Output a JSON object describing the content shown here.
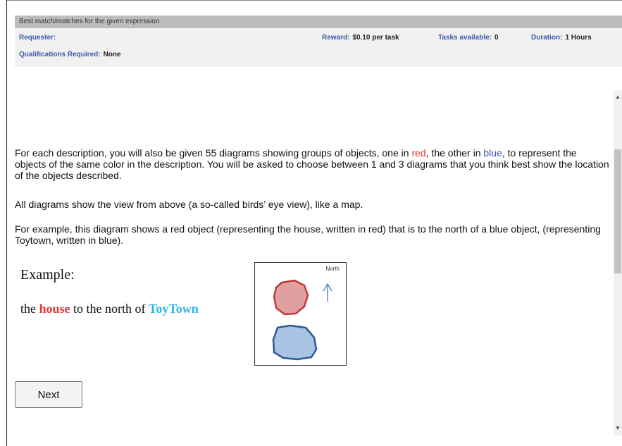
{
  "hit": {
    "title": "Best match/matches for the given expression",
    "requester_label": "Requester:",
    "reward_label": "Reward:",
    "reward_value": "$0.10 per task",
    "tasks_label": "Tasks available:",
    "tasks_value": "0",
    "duration_label": "Duration:",
    "duration_value": "1 Hours",
    "qualifications_label": "Qualifications Required:",
    "qualifications_value": "None"
  },
  "instructions": {
    "p1_a": "For each description, you will also be given 55 diagrams showing groups of objects, one in ",
    "p1_red": "red",
    "p1_b": ", the other in ",
    "p1_blue": "blue",
    "p1_c": ", to represent the objects of the same color in the description. You will be asked to choose between 1 and 3 diagrams that you think best show the location of the objects described.",
    "p2": "All diagrams show the view from above (a so-called birds’ eye view), like a map.",
    "p3": "For example, this diagram shows a red object (representing the house, written in red) that is to the north of a blue object, (representing Toytown, written in blue)."
  },
  "example": {
    "label": "Example:",
    "phrase_1": "the ",
    "phrase_red": "house",
    "phrase_2": " to the north of ",
    "phrase_cyan": "ToyTown",
    "diagram_north_label": "North",
    "colors": {
      "red_fill": "#e0a0a0",
      "red_stroke": "#c0393b",
      "blue_fill": "#a8c4e2",
      "blue_stroke": "#2c5a92",
      "arrow": "#5b8cc9"
    }
  },
  "buttons": {
    "next": "Next"
  },
  "icons": {
    "scroll_up": "triangle-up-icon",
    "scroll_down": "triangle-down-icon"
  }
}
